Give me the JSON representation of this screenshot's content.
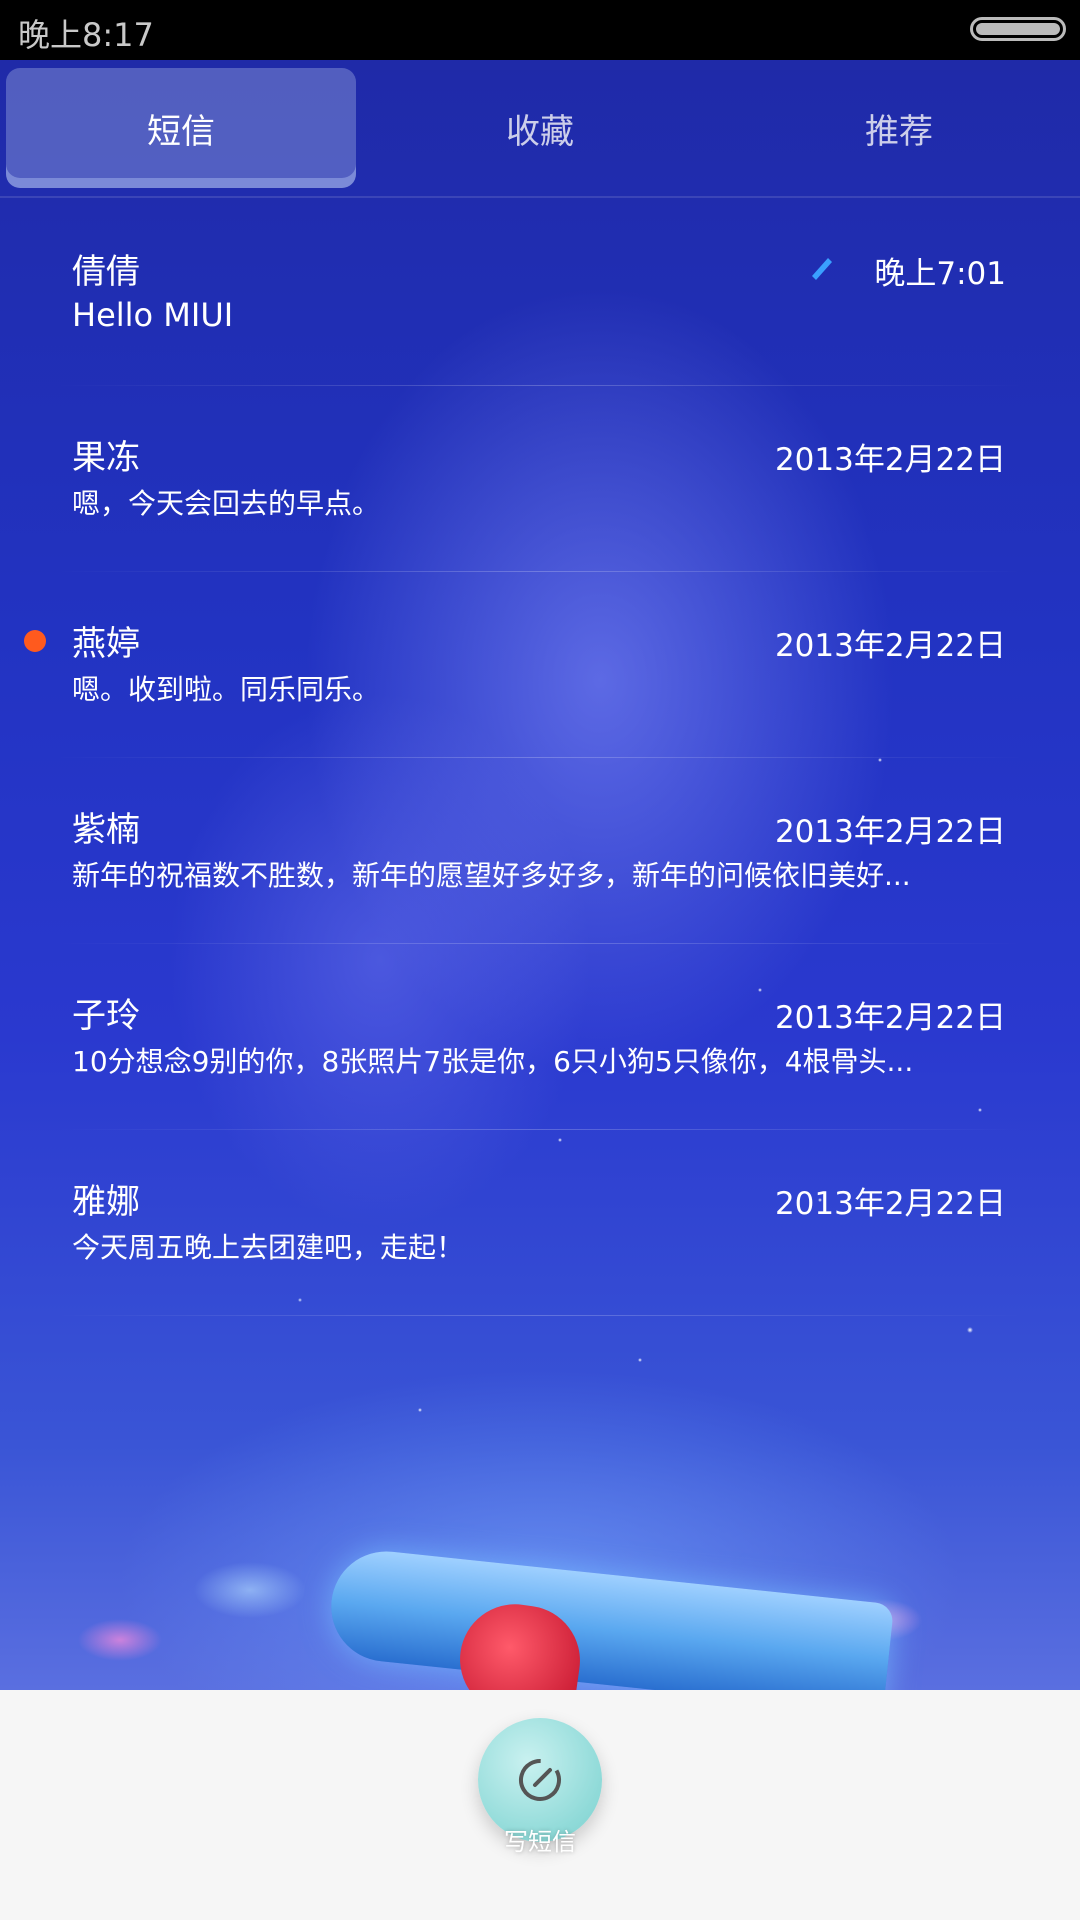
{
  "status_bar": {
    "time": "晚上8:17"
  },
  "tabs": [
    {
      "label": "短信",
      "active": true
    },
    {
      "label": "收藏",
      "active": false
    },
    {
      "label": "推荐",
      "active": false
    }
  ],
  "messages": [
    {
      "name": "倩倩",
      "time": "晚上7:01",
      "preview": "Hello MIUI",
      "unread": false,
      "draft": true
    },
    {
      "name": "果冻",
      "time": "2013年2月22日",
      "preview": "嗯，今天会回去的早点。",
      "unread": false,
      "draft": false
    },
    {
      "name": "燕婷",
      "time": "2013年2月22日",
      "preview": "嗯。收到啦。同乐同乐。",
      "unread": true,
      "draft": false
    },
    {
      "name": "紫楠",
      "time": "2013年2月22日",
      "preview": "新年的祝福数不胜数，新年的愿望好多好多，新年的问候依旧美好...",
      "unread": false,
      "draft": false
    },
    {
      "name": "子玲",
      "time": "2013年2月22日",
      "preview": "10分想念9别的你，8张照片7张是你，6只小狗5只像你，4根骨头...",
      "unread": false,
      "draft": false
    },
    {
      "name": "雅娜",
      "time": "2013年2月22日",
      "preview": "今天周五晚上去团建吧，走起！",
      "unread": false,
      "draft": false
    }
  ],
  "compose": {
    "label": "写短信",
    "icon": "compose-icon"
  },
  "colors": {
    "unread_dot": "#ff5a1e",
    "compose_button": "#8fdad8",
    "bottom_bar": "#f6f6f6"
  }
}
